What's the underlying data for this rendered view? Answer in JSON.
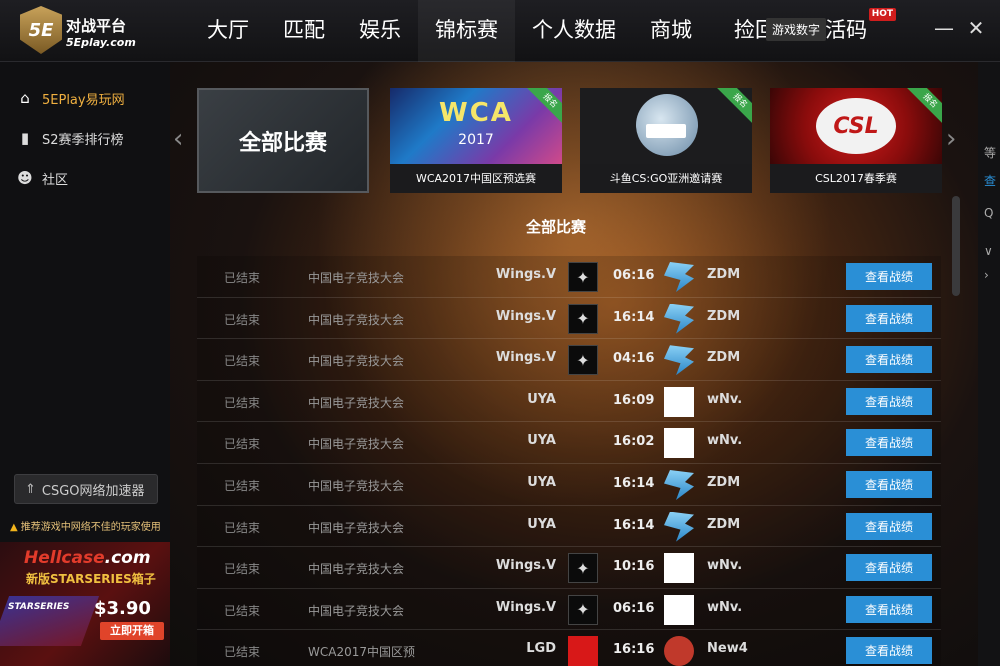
{
  "app": {
    "logo_badge": "5E",
    "logo_title": "对战平台",
    "logo_sub": "5Eplay.com"
  },
  "nav": {
    "items": [
      "大厅",
      "匹配",
      "娱乐",
      "锦标赛",
      "个人数据",
      "商城"
    ],
    "hot_item": "捡回服:数活码",
    "hot_badge": "HOT",
    "game_tip": "游戏数字"
  },
  "window": {
    "minimize": "—",
    "close": "✕"
  },
  "sidebar": {
    "items": [
      {
        "label": "5EPlay易玩网",
        "icon": "home-icon"
      },
      {
        "label": "S2赛季排行榜",
        "icon": "bar-chart-icon"
      },
      {
        "label": "社区",
        "icon": "users-icon"
      }
    ],
    "accelerator": "CSGO网络加速器",
    "warning": "推荐游戏中网络不佳的玩家使用",
    "ad": {
      "brand_a": "Hellcase",
      "brand_b": ".com",
      "sub": "新版STARSERIES箱子",
      "gun_text": "STARSERIES",
      "price": "$3.90",
      "cta": "立即开箱"
    }
  },
  "carousel": {
    "prev": "‹",
    "next": "›",
    "all_label": "全部比赛",
    "ribbon": "报名",
    "cards": [
      {
        "caption": "WCA2017中国区预选赛",
        "logo": "WCA",
        "year": "2017"
      },
      {
        "caption": "斗鱼CS:GO亚洲邀请赛"
      },
      {
        "caption": "CSL2017春季赛",
        "logo": "CSL"
      }
    ]
  },
  "section_title": "全部比赛",
  "matches": [
    {
      "status": "已结束",
      "league": "中国电子竞技大会",
      "team1": "Wings.V",
      "logo1": "wings",
      "score": "06:16",
      "logo2": "zdm",
      "team2": "ZDM",
      "button": "查看战绩"
    },
    {
      "status": "已结束",
      "league": "中国电子竞技大会",
      "team1": "Wings.V",
      "logo1": "wings",
      "score": "16:14",
      "logo2": "zdm",
      "team2": "ZDM",
      "button": "查看战绩"
    },
    {
      "status": "已结束",
      "league": "中国电子竞技大会",
      "team1": "Wings.V",
      "logo1": "wings",
      "score": "04:16",
      "logo2": "zdm",
      "team2": "ZDM",
      "button": "查看战绩"
    },
    {
      "status": "已结束",
      "league": "中国电子竞技大会",
      "team1": "UYA",
      "logo1": "uya",
      "score": "16:09",
      "logo2": "wnv",
      "team2": "wNv.",
      "button": "查看战绩"
    },
    {
      "status": "已结束",
      "league": "中国电子竞技大会",
      "team1": "UYA",
      "logo1": "uya",
      "score": "16:02",
      "logo2": "wnv",
      "team2": "wNv.",
      "button": "查看战绩"
    },
    {
      "status": "已结束",
      "league": "中国电子竞技大会",
      "team1": "UYA",
      "logo1": "uya",
      "score": "16:14",
      "logo2": "zdm",
      "team2": "ZDM",
      "button": "查看战绩"
    },
    {
      "status": "已结束",
      "league": "中国电子竞技大会",
      "team1": "UYA",
      "logo1": "uya",
      "score": "16:14",
      "logo2": "zdm",
      "team2": "ZDM",
      "button": "查看战绩"
    },
    {
      "status": "已结束",
      "league": "中国电子竞技大会",
      "team1": "Wings.V",
      "logo1": "wings",
      "score": "10:16",
      "logo2": "wnv",
      "team2": "wNv.",
      "button": "查看战绩"
    },
    {
      "status": "已结束",
      "league": "中国电子竞技大会",
      "team1": "Wings.V",
      "logo1": "wings",
      "score": "06:16",
      "logo2": "wnv",
      "team2": "wNv.",
      "button": "查看战绩"
    },
    {
      "status": "已结束",
      "league": "WCA2017中国区预",
      "team1": "LGD",
      "logo1": "lgd",
      "score": "16:16",
      "logo2": "new4",
      "team2": "New4",
      "button": "查看战绩"
    }
  ],
  "right_strip": [
    "等",
    "查",
    "Q",
    "∨",
    "›"
  ],
  "colors": {
    "accent_blue": "#2a8fd6",
    "active_gold": "#f0b040",
    "hot_red": "#d01d1d",
    "ribbon_green": "#3aa64a"
  }
}
